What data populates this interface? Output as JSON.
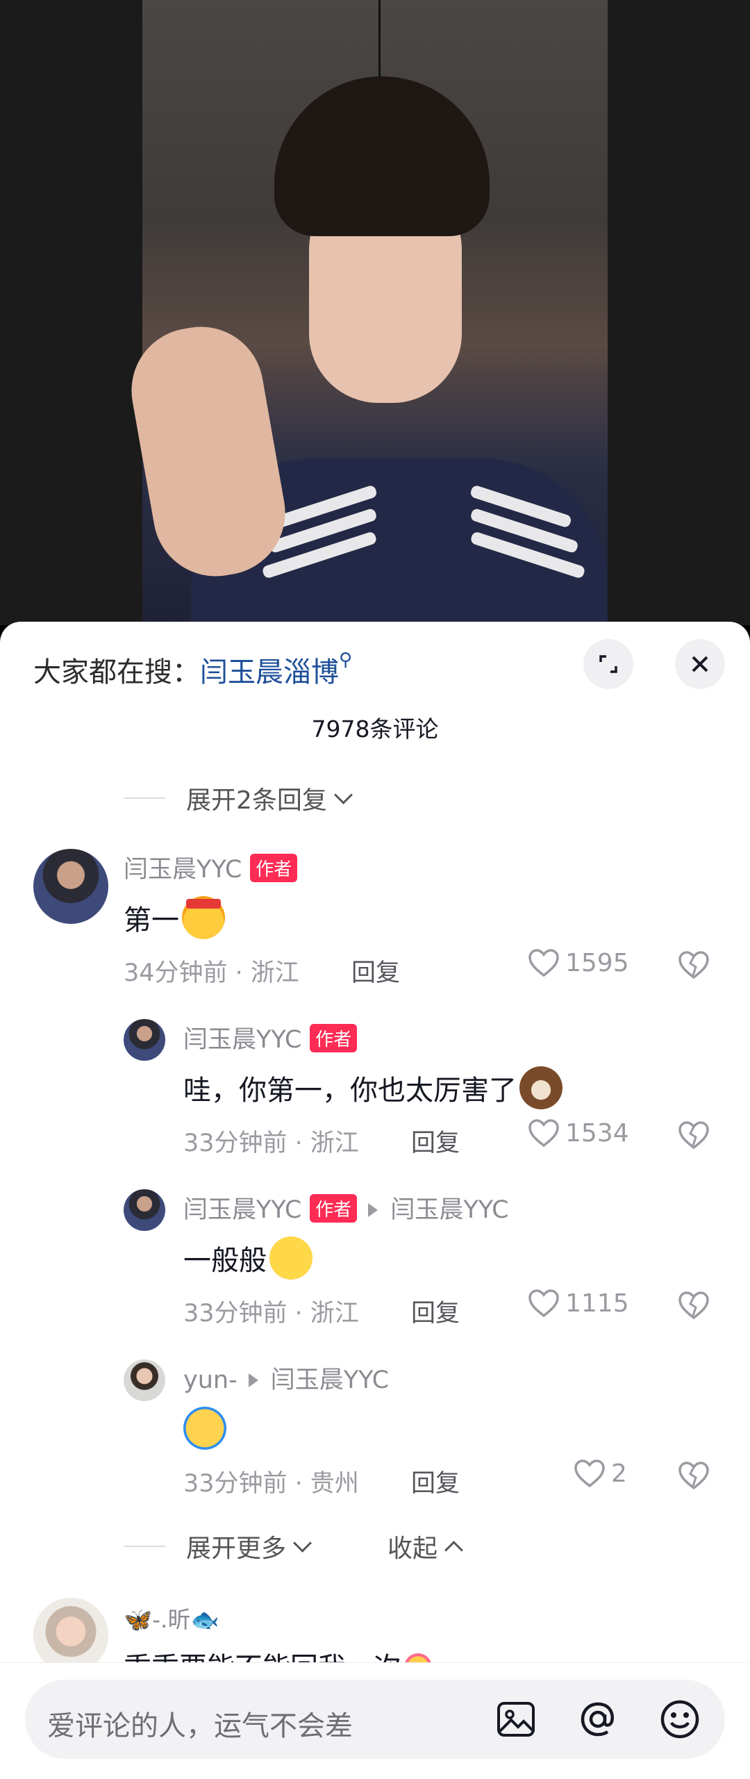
{
  "video": {},
  "header": {
    "hot_search_prefix": "大家都在搜：",
    "hot_search_keyword": "闫玉晨淄博",
    "comment_count": "7978条评论"
  },
  "expand_top": "展开2条回复",
  "comments": [
    {
      "name": "闫玉晨YYC",
      "badge": "作者",
      "text": "第一",
      "emoji": "angry-headband-emoji",
      "time_location": "34分钟前 · 浙江",
      "reply": "回复",
      "likes": "1595"
    }
  ],
  "replies": [
    {
      "name": "闫玉晨YYC",
      "badge": "作者",
      "target": "",
      "text": "哇，你第一，你也太厉害了",
      "emoji": "dog-emoji",
      "time_location": "33分钟前 · 浙江",
      "reply": "回复",
      "likes": "1534"
    },
    {
      "name": "闫玉晨YYC",
      "badge": "作者",
      "target": "闫玉晨YYC",
      "text": "一般般",
      "emoji": "thinking-emoji",
      "time_location": "33分钟前 · 浙江",
      "reply": "回复",
      "likes": "1115"
    },
    {
      "name": "yun-",
      "badge": "",
      "target": "闫玉晨YYC",
      "text": "",
      "emoji": "crying-emoji",
      "time_location": "33分钟前 · 贵州",
      "reply": "回复",
      "likes": "2"
    }
  ],
  "expand_more": "展开更多",
  "collapse": "收起",
  "next_comment": {
    "name": "-.昕",
    "text": "乖乖要能不能回我一次"
  },
  "input": {
    "placeholder": "爱评论的人，运气不会差"
  },
  "icons": [
    "search-icon",
    "expand-icon",
    "close-icon",
    "heart-icon",
    "broken-heart-icon",
    "image-icon",
    "at-icon",
    "emoji-icon"
  ]
}
